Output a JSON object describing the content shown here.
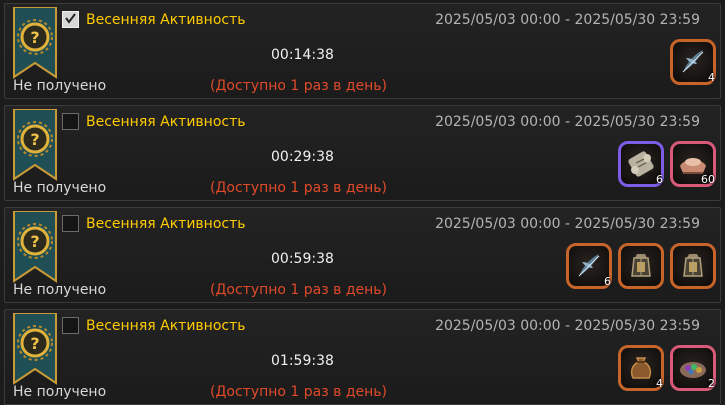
{
  "colors": {
    "title": "#ffcc00",
    "limit_text": "#e04a2a",
    "frame_orange": "#c7642a",
    "frame_purple": "#7d5ce6",
    "frame_pink": "#d85a78"
  },
  "events": [
    {
      "checked": true,
      "title": "Весенняя Активность",
      "period": "2025/05/03 00:00 - 2025/05/30 23:59",
      "timer": "00:14:38",
      "limit": "(Доступно 1 раз в день)",
      "status": "Не получено",
      "rewards": [
        {
          "icon": "feather-icon",
          "frame": "orange",
          "qty": "4"
        }
      ]
    },
    {
      "checked": false,
      "title": "Весенняя Активность",
      "period": "2025/05/03 00:00 - 2025/05/30 23:59",
      "timer": "00:29:38",
      "limit": "(Доступно 1 раз в день)",
      "status": "Не получено",
      "rewards": [
        {
          "icon": "scroll-icon",
          "frame": "purple",
          "qty": "6"
        },
        {
          "icon": "ingot-icon",
          "frame": "pink",
          "qty": "60"
        }
      ]
    },
    {
      "checked": false,
      "title": "Весенняя Активность",
      "period": "2025/05/03 00:00 - 2025/05/30 23:59",
      "timer": "00:59:38",
      "limit": "(Доступно 1 раз в день)",
      "status": "Не получено",
      "rewards": [
        {
          "icon": "feather-icon",
          "frame": "orange",
          "qty": "6"
        },
        {
          "icon": "lantern-icon",
          "frame": "orange",
          "qty": ""
        },
        {
          "icon": "lantern-icon",
          "frame": "orange",
          "qty": ""
        }
      ]
    },
    {
      "checked": false,
      "title": "Весенняя Активность",
      "period": "2025/05/03 00:00 - 2025/05/30 23:59",
      "timer": "01:59:38",
      "limit": "(Доступно 1 раз в день)",
      "status": "Не получено",
      "rewards": [
        {
          "icon": "pouch-icon",
          "frame": "orange",
          "qty": "4"
        },
        {
          "icon": "gem-bowl-icon",
          "frame": "pink",
          "qty": "2"
        }
      ]
    }
  ]
}
